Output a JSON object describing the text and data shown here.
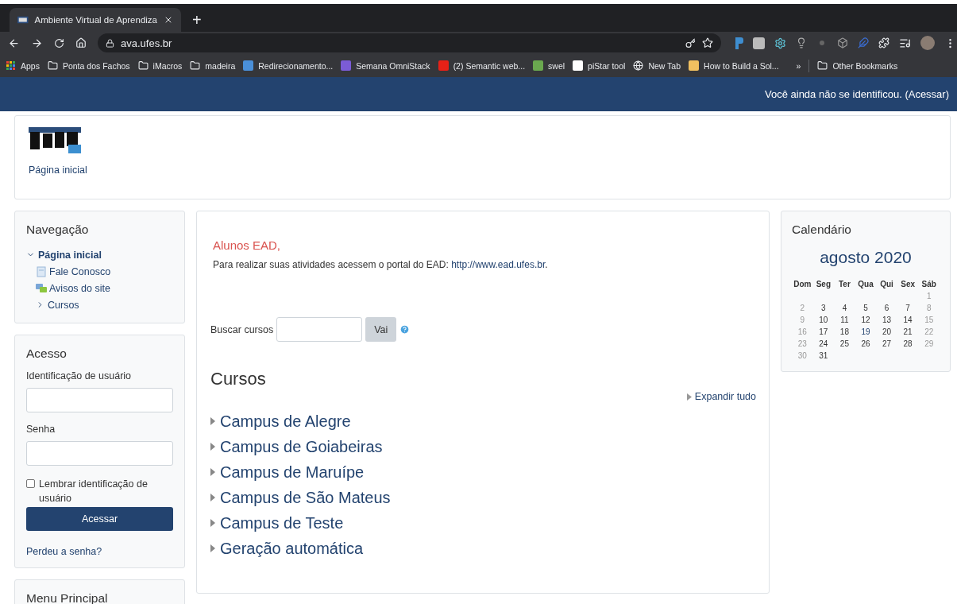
{
  "browser": {
    "tab": {
      "title": "Ambiente Virtual de Aprendiza",
      "selected": true
    },
    "new_tab": "+",
    "url": "ava.ufes.br",
    "bookmarks": [
      {
        "label": "Apps",
        "kind": "apps"
      },
      {
        "label": "Ponta dos Fachos",
        "kind": "folder"
      },
      {
        "label": "iMacros",
        "kind": "folder"
      },
      {
        "label": "madeira",
        "kind": "folder"
      },
      {
        "label": "Redirecionamento...",
        "kind": "site",
        "color": "#4a8fd8"
      },
      {
        "label": "Semana OmniStack",
        "kind": "site",
        "color": "#7b5cd6"
      },
      {
        "label": "(2) Semantic web...",
        "kind": "site",
        "color": "#e62117"
      },
      {
        "label": "swel",
        "kind": "site",
        "color": "#6aa84f"
      },
      {
        "label": "piStar tool",
        "kind": "site",
        "color": "#ffffff"
      },
      {
        "label": "New Tab",
        "kind": "globe"
      },
      {
        "label": "How to Build a Sol...",
        "kind": "site",
        "color": "#f0c060"
      }
    ],
    "overflow": "»",
    "other_bookmarks": "Other Bookmarks"
  },
  "header": {
    "notice": "Você ainda não se identificou.",
    "login_link": "(Acessar)"
  },
  "site": {
    "home_link": "Página inicial"
  },
  "navigation": {
    "title": "Navegação",
    "items": [
      {
        "label": "Página inicial",
        "kind": "branch",
        "expanded": true,
        "children": [
          {
            "label": "Fale Conosco",
            "kind": "page"
          },
          {
            "label": "Avisos do site",
            "kind": "forum"
          },
          {
            "label": "Cursos",
            "kind": "branch",
            "expanded": false
          }
        ]
      }
    ]
  },
  "login": {
    "title": "Acesso",
    "username_label": "Identificação de usuário",
    "password_label": "Senha",
    "remember": {
      "label": "Lembrar identificação de usuário",
      "checked": false
    },
    "submit": "Acessar",
    "forgot": "Perdeu a senha?"
  },
  "next_block": {
    "title": "Menu Principal"
  },
  "main": {
    "notice_title": "Alunos EAD,",
    "notice_text": "Para realizar suas atividades acessem o portal do EAD: ",
    "notice_link": "http://www.ead.ufes.br",
    "notice_end": ".",
    "search": {
      "label": "Buscar cursos",
      "button": "Vai"
    },
    "courses": {
      "title": "Cursos",
      "expand_all": "Expandir tudo",
      "categories": [
        {
          "label": "Campus de Alegre",
          "expanded": false
        },
        {
          "label": "Campus de Goiabeiras",
          "expanded": false
        },
        {
          "label": "Campus de Maruípe",
          "expanded": false
        },
        {
          "label": "Campus de São Mateus",
          "expanded": false
        },
        {
          "label": "Campus de Teste",
          "expanded": false
        },
        {
          "label": "Geração automática",
          "expanded": false
        }
      ]
    }
  },
  "calendar": {
    "title": "Calendário",
    "month": "agosto 2020",
    "weekdays": [
      "Dom",
      "Seg",
      "Ter",
      "Qua",
      "Qui",
      "Sex",
      "Sáb"
    ],
    "weeks": [
      [
        {
          "day": "1",
          "kind": "weekend"
        }
      ],
      [
        {
          "day": "2",
          "kind": "weekend"
        },
        {
          "day": "3",
          "kind": "weekday"
        },
        {
          "day": "4",
          "kind": "weekday"
        },
        {
          "day": "5",
          "kind": "weekday"
        },
        {
          "day": "6",
          "kind": "weekday"
        },
        {
          "day": "7",
          "kind": "weekday"
        },
        {
          "day": "8",
          "kind": "weekend"
        }
      ],
      [
        {
          "day": "9",
          "kind": "weekend"
        },
        {
          "day": "10",
          "kind": "weekday"
        },
        {
          "day": "11",
          "kind": "weekday"
        },
        {
          "day": "12",
          "kind": "weekday"
        },
        {
          "day": "13",
          "kind": "weekday"
        },
        {
          "day": "14",
          "kind": "weekday"
        },
        {
          "day": "15",
          "kind": "weekend"
        }
      ],
      [
        {
          "day": "16",
          "kind": "weekend"
        },
        {
          "day": "17",
          "kind": "weekday"
        },
        {
          "day": "18",
          "kind": "weekday"
        },
        {
          "day": "19",
          "kind": "today"
        },
        {
          "day": "20",
          "kind": "weekday"
        },
        {
          "day": "21",
          "kind": "weekday"
        },
        {
          "day": "22",
          "kind": "weekend"
        }
      ],
      [
        {
          "day": "23",
          "kind": "weekend"
        },
        {
          "day": "24",
          "kind": "weekday"
        },
        {
          "day": "25",
          "kind": "weekday"
        },
        {
          "day": "26",
          "kind": "weekday"
        },
        {
          "day": "27",
          "kind": "weekday"
        },
        {
          "day": "28",
          "kind": "weekday"
        },
        {
          "day": "29",
          "kind": "weekend"
        }
      ],
      [
        {
          "day": "30",
          "kind": "weekend"
        },
        {
          "day": "31",
          "kind": "weekday"
        }
      ]
    ]
  }
}
